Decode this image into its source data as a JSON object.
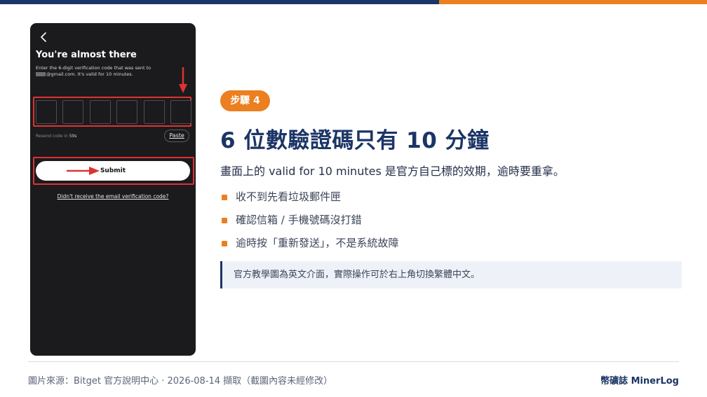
{
  "colors": {
    "navy": "#1b3566",
    "orange": "#ec7f1f",
    "highlight_red": "#e03232"
  },
  "phone": {
    "back_icon": "chevron-left-icon",
    "title": "You're almost there",
    "desc_line1": "Enter the 6-digit verification code that was sent to",
    "desc_line2": "@gmail.com. It's valid for 10 minutes.",
    "code_boxes": [
      "",
      "",
      "",
      "",
      "",
      ""
    ],
    "resend_label": "Resend code in",
    "resend_seconds": "59s",
    "paste_label": "Paste",
    "submit_label": "Submit",
    "didnt_receive": "Didn't receive the email verification code?"
  },
  "content": {
    "step_badge": "步驟 4",
    "title": "6 位數驗證碼只有 10 分鐘",
    "subtitle": "畫面上的 valid for 10 minutes 是官方自己標的效期，逾時要重拿。",
    "bullets": [
      "收不到先看垃圾郵件匣",
      "確認信箱 / 手機號碼沒打錯",
      "逾時按「重新發送」，不是系統故障"
    ],
    "note": "官方教學圖為英文介面，實際操作可於右上角切換繁體中文。"
  },
  "footer": {
    "source": "圖片來源：Bitget 官方說明中心 · 2026-08-14 擷取（截圖內容未經修改）",
    "brand": "幣礦誌 MinerLog"
  }
}
